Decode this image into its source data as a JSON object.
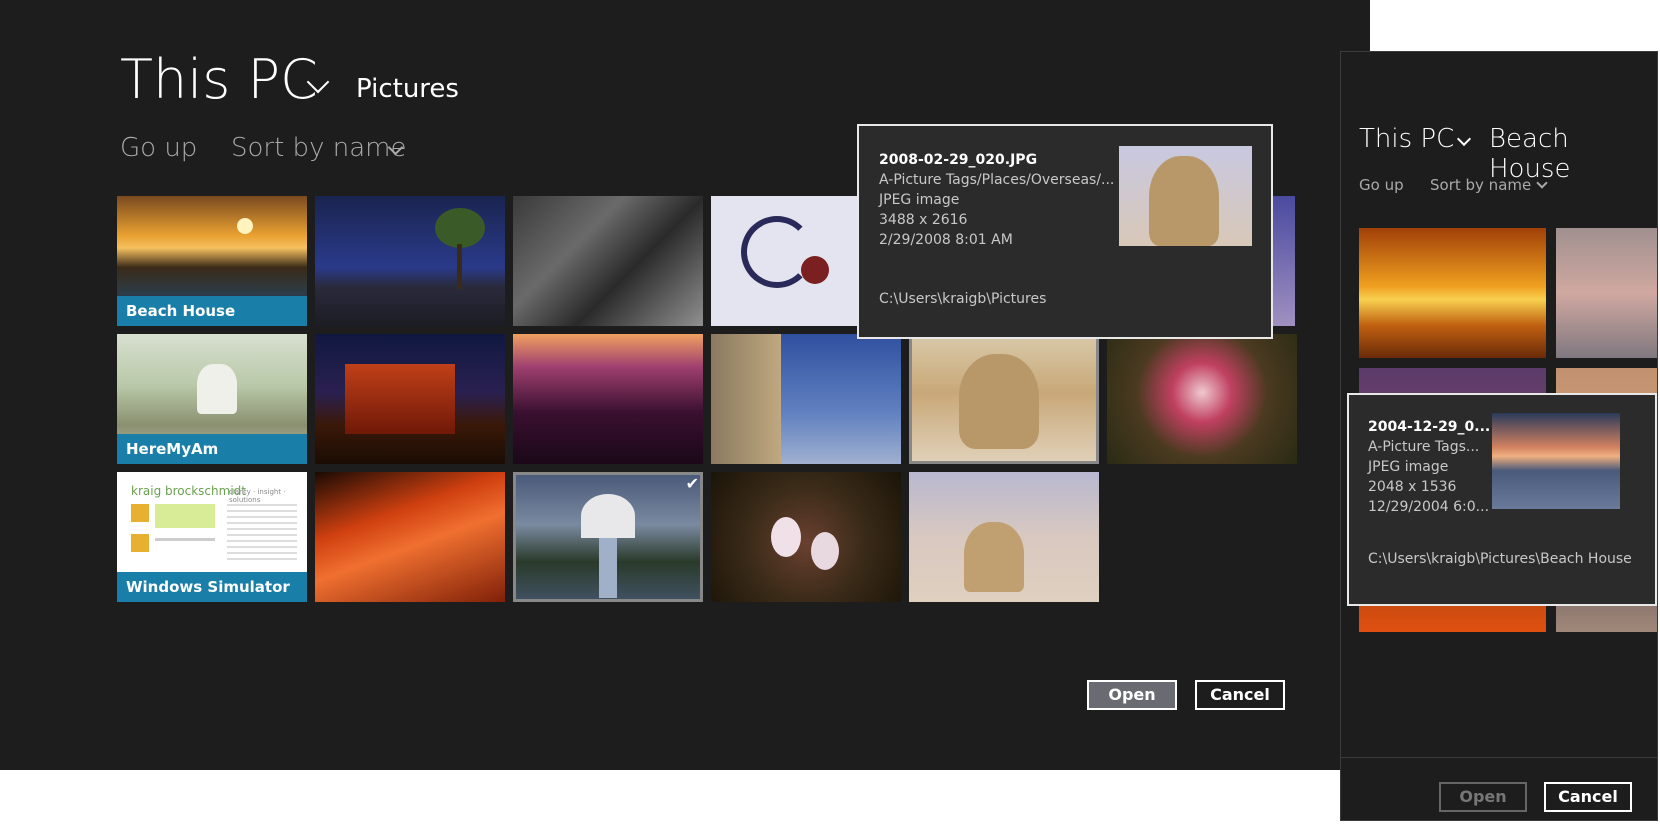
{
  "main": {
    "location": "This PC",
    "folder": "Pictures",
    "go_up": "Go up",
    "sort_label": "Sort by name",
    "tiles": [
      {
        "label": "Beach House"
      },
      {
        "label": "HereMyAm"
      },
      {
        "label": "Windows Simulator"
      }
    ],
    "open_label": "Open",
    "cancel_label": "Cancel",
    "website_text": "kraig brockschmidt",
    "website_tagline": "clarity · insight · solutions"
  },
  "tooltip1": {
    "name": "2008-02-29_020.JPG",
    "tags": "A-Picture Tags/Places/Overseas/...",
    "type": "JPEG image",
    "dimensions": "3488 x 2616",
    "date": "2/29/2008 8:01 AM",
    "path": "C:\\Users\\kraigb\\Pictures"
  },
  "side": {
    "location": "This PC",
    "folder": "Beach House",
    "go_up": "Go up",
    "sort_label": "Sort by name",
    "open_label": "Open",
    "cancel_label": "Cancel"
  },
  "tooltip2": {
    "name": "2004-12-29_0...",
    "tags": "A-Picture Tags...",
    "type": "JPEG image",
    "dimensions": "2048 x 1536",
    "date": "12/29/2004 6:0...",
    "path": "C:\\Users\\kraigb\\Pictures\\Beach House"
  }
}
